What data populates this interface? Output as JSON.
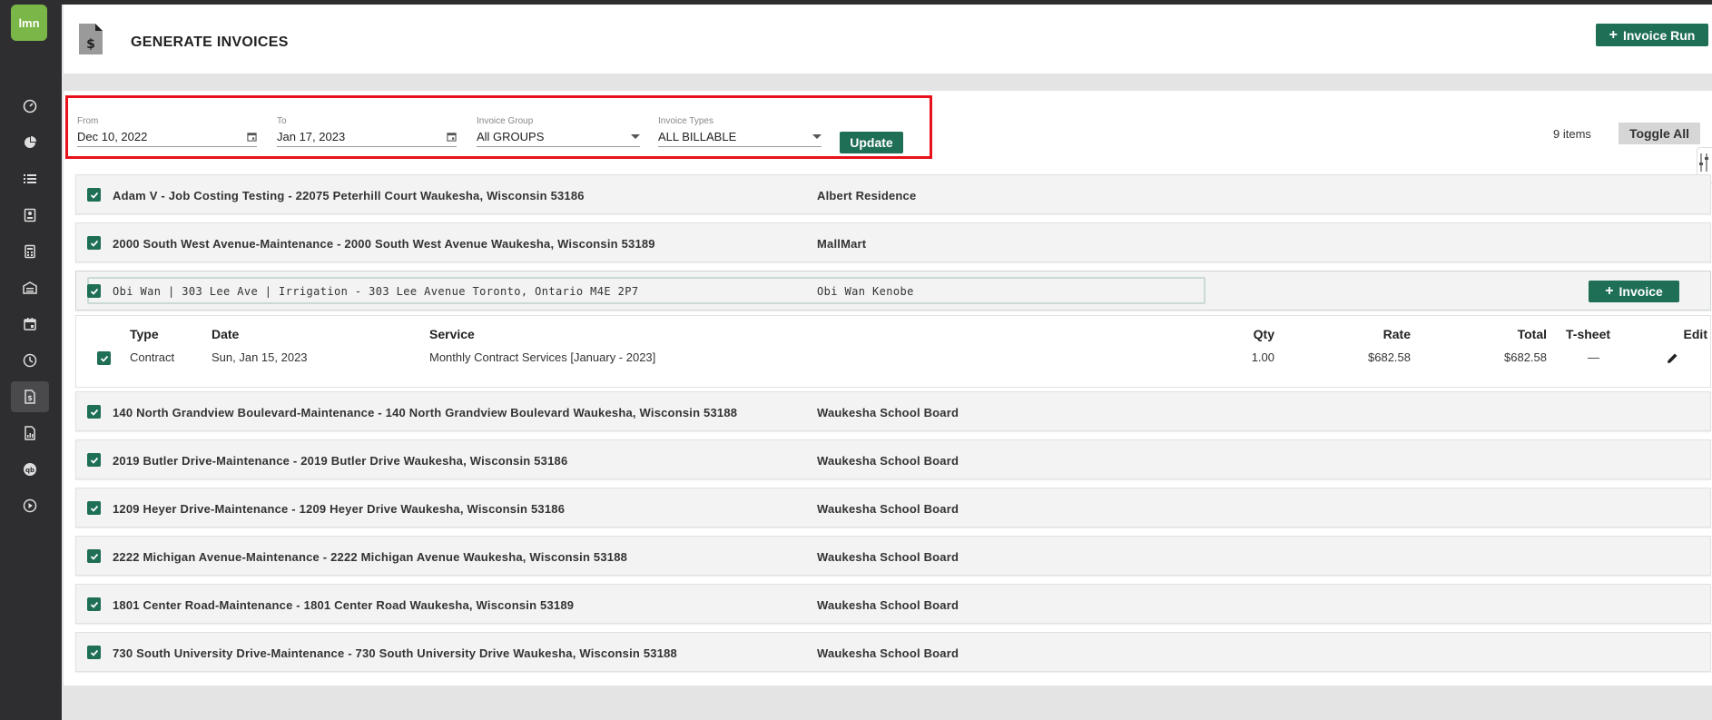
{
  "app": {
    "logo_text": "lmn",
    "accent_color": "#1f6e56",
    "logo_color": "#7ab648"
  },
  "sidebar": {
    "items": [
      {
        "name": "dashboard-icon"
      },
      {
        "name": "pie-chart-icon"
      },
      {
        "name": "list-icon"
      },
      {
        "name": "contact-card-icon"
      },
      {
        "name": "calculator-icon"
      },
      {
        "name": "warehouse-icon"
      },
      {
        "name": "calendar-icon"
      },
      {
        "name": "clock-icon"
      },
      {
        "name": "invoice-icon",
        "active": true
      },
      {
        "name": "report-icon"
      },
      {
        "name": "quickbooks-icon"
      },
      {
        "name": "play-icon"
      }
    ]
  },
  "header": {
    "title": "GENERATE INVOICES",
    "invoice_run_label": "Invoice Run"
  },
  "filters": {
    "from_label": "From",
    "from_value": "Dec 10, 2022",
    "to_label": "To",
    "to_value": "Jan 17, 2023",
    "group_label": "Invoice Group",
    "group_value": "All GROUPS",
    "types_label": "Invoice Types",
    "types_value": "ALL BILLABLE",
    "update_label": "Update"
  },
  "toolbar": {
    "items_count": "9 items",
    "toggle_all_label": "Toggle All"
  },
  "jobs": [
    {
      "title": "Adam V - Job Costing Testing - 22075 Peterhill Court Waukesha, Wisconsin 53186",
      "customer": "Albert Residence"
    },
    {
      "title": "2000 South West Avenue-Maintenance - 2000 South West Avenue Waukesha, Wisconsin 53189",
      "customer": "MallMart"
    },
    {
      "title": "Obi Wan | 303 Lee Ave | Irrigation - 303 Lee Avenue Toronto, Ontario M4E 2P7",
      "customer": "Obi Wan Kenobe",
      "expanded": true,
      "invoice_label": "Invoice"
    },
    {
      "title": "140 North Grandview Boulevard-Maintenance - 140 North Grandview Boulevard Waukesha, Wisconsin 53188",
      "customer": "Waukesha School Board"
    },
    {
      "title": "2019 Butler Drive-Maintenance - 2019 Butler Drive Waukesha, Wisconsin 53186",
      "customer": "Waukesha School Board"
    },
    {
      "title": "1209 Heyer Drive-Maintenance - 1209 Heyer Drive Waukesha, Wisconsin 53186",
      "customer": "Waukesha School Board"
    },
    {
      "title": "2222 Michigan Avenue-Maintenance - 2222 Michigan Avenue Waukesha, Wisconsin 53188",
      "customer": "Waukesha School Board"
    },
    {
      "title": "1801 Center Road-Maintenance - 1801 Center Road Waukesha, Wisconsin 53189",
      "customer": "Waukesha School Board"
    },
    {
      "title": "730 South University Drive-Maintenance - 730 South University Drive Waukesha, Wisconsin 53188",
      "customer": "Waukesha School Board"
    }
  ],
  "detail": {
    "headers": {
      "type": "Type",
      "date": "Date",
      "service": "Service",
      "qty": "Qty",
      "rate": "Rate",
      "total": "Total",
      "tsheet": "T-sheet",
      "edit": "Edit"
    },
    "rows": [
      {
        "type": "Contract",
        "date": "Sun, Jan 15, 2023",
        "service": "Monthly Contract Services [January - 2023]",
        "qty": "1.00",
        "rate": "$682.58",
        "total": "$682.58",
        "tsheet": "—"
      }
    ]
  }
}
